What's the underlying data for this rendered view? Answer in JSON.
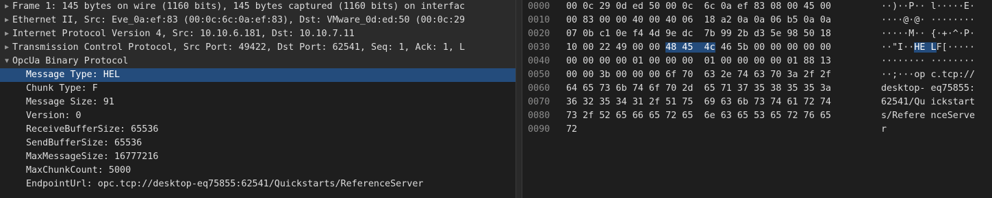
{
  "tree": {
    "rows": [
      {
        "arrow": "▶",
        "text": "Frame 1: 145 bytes on wire (1160 bits), 145 bytes captured (1160 bits) on interfac",
        "hdr": true
      },
      {
        "arrow": "▶",
        "text": "Ethernet II, Src: Eve_0a:ef:83 (00:0c:6c:0a:ef:83), Dst: VMware_0d:ed:50 (00:0c:29",
        "hdr": true
      },
      {
        "arrow": "▶",
        "text": "Internet Protocol Version 4, Src: 10.10.6.181, Dst: 10.10.7.11",
        "hdr": true
      },
      {
        "arrow": "▶",
        "text": "Transmission Control Protocol, Src Port: 49422, Dst Port: 62541, Seq: 1, Ack: 1, L",
        "hdr": true
      },
      {
        "arrow": "▼",
        "text": "OpcUa Binary Protocol",
        "hdr": true
      }
    ],
    "fields": [
      {
        "text": "Message Type: HEL",
        "selected": true
      },
      {
        "text": "Chunk Type: F"
      },
      {
        "text": "Message Size: 91"
      },
      {
        "text": "Version: 0"
      },
      {
        "text": "ReceiveBufferSize: 65536"
      },
      {
        "text": "SendBufferSize: 65536"
      },
      {
        "text": "MaxMessageSize: 16777216"
      },
      {
        "text": "MaxChunkCount: 5000"
      },
      {
        "text": "EndpointUrl: opc.tcp://desktop-eq75855:62541/Quickstarts/ReferenceServer"
      }
    ]
  },
  "hex": {
    "lines": [
      {
        "off": "0000",
        "b1": "00 0c 29 0d ed 50 00 0c  6c 0a ef 83 08 00 45 00",
        "hl": "",
        "b2": "",
        "a1": "··)··P·· l·····E·",
        "ahl": "",
        "a2": ""
      },
      {
        "off": "0010",
        "b1": "00 83 00 00 40 00 40 06  18 a2 0a 0a 06 b5 0a 0a",
        "hl": "",
        "b2": "",
        "a1": "····@·@· ········",
        "ahl": "",
        "a2": ""
      },
      {
        "off": "0020",
        "b1": "07 0b c1 0e f4 4d 9e dc  7b 99 2b d3 5e 98 50 18",
        "hl": "",
        "b2": "",
        "a1": "·····M·· {·+·^·P·",
        "ahl": "",
        "a2": ""
      },
      {
        "off": "0030",
        "b1": "10 00 22 49 00 00 ",
        "hl": "48 45  4c",
        "b2": " 46 5b 00 00 00 00 00",
        "a1": "··\"I··",
        "ahl": "HE L",
        "a2": "F[·····"
      },
      {
        "off": "0040",
        "b1": "00 00 00 00 01 00 00 00  01 00 00 00 00 01 88 13",
        "hl": "",
        "b2": "",
        "a1": "········ ········",
        "ahl": "",
        "a2": ""
      },
      {
        "off": "0050",
        "b1": "00 00 3b 00 00 00 6f 70  63 2e 74 63 70 3a 2f 2f",
        "hl": "",
        "b2": "",
        "a1": "··;···op c.tcp://",
        "ahl": "",
        "a2": ""
      },
      {
        "off": "0060",
        "b1": "64 65 73 6b 74 6f 70 2d  65 71 37 35 38 35 35 3a",
        "hl": "",
        "b2": "",
        "a1": "desktop- eq75855:",
        "ahl": "",
        "a2": ""
      },
      {
        "off": "0070",
        "b1": "36 32 35 34 31 2f 51 75  69 63 6b 73 74 61 72 74",
        "hl": "",
        "b2": "",
        "a1": "62541/Qu ickstart",
        "ahl": "",
        "a2": ""
      },
      {
        "off": "0080",
        "b1": "73 2f 52 65 66 65 72 65  6e 63 65 53 65 72 76 65",
        "hl": "",
        "b2": "",
        "a1": "s/Refere nceServe",
        "ahl": "",
        "a2": ""
      },
      {
        "off": "0090",
        "b1": "72",
        "hl": "",
        "b2": "",
        "a1": "r",
        "ahl": "",
        "a2": ""
      }
    ]
  }
}
